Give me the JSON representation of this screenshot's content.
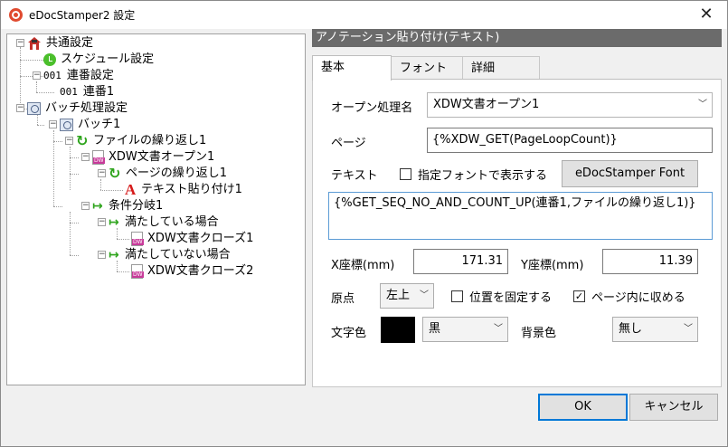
{
  "window": {
    "title": "eDocStamper2 設定",
    "close_glyph": "✕"
  },
  "tree": {
    "items": [
      {
        "label": "共通設定"
      },
      {
        "label": "スケジュール設定"
      },
      {
        "label": "連番設定",
        "num": "001"
      },
      {
        "label": "連番1",
        "num": "001"
      },
      {
        "label": "バッチ処理設定"
      },
      {
        "label": "バッチ1"
      },
      {
        "label": "ファイルの繰り返し1"
      },
      {
        "label": "XDW文書オープン1"
      },
      {
        "label": "ページの繰り返し1"
      },
      {
        "label": "テキスト貼り付け1"
      },
      {
        "label": "条件分岐1"
      },
      {
        "label": "満たしている場合"
      },
      {
        "label": "XDW文書クローズ1"
      },
      {
        "label": "満たしていない場合"
      },
      {
        "label": "XDW文書クローズ2"
      }
    ]
  },
  "panel": {
    "header": "アノテーション貼り付け(テキスト)",
    "tabs": [
      "基本",
      "フォント",
      "詳細"
    ],
    "open_label": "オープン処理名",
    "open_value": "XDW文書オープン1",
    "page_label": "ページ",
    "page_value": "{%XDW_GET(PageLoopCount)}",
    "text_label": "テキスト",
    "font_check_label": "指定フォントで表示する",
    "font_button": "eDocStamper Font",
    "text_value": "{%GET_SEQ_NO_AND_COUNT_UP(連番1,ファイルの繰り返し1)}",
    "x_label": "X座標(mm)",
    "x_value": "171.31",
    "y_label": "Y座標(mm)",
    "y_value": "11.39",
    "origin_label": "原点",
    "origin_value": "左上",
    "fix_pos_label": "位置を固定する",
    "fit_page_label": "ページ内に収める",
    "fit_page_checked": "✓",
    "text_color_label": "文字色",
    "text_color_value": "黒",
    "bg_color_label": "背景色",
    "bg_color_value": "無し",
    "text_color_hex": "#000000"
  },
  "footer": {
    "ok": "OK",
    "cancel": "キャンセル"
  }
}
